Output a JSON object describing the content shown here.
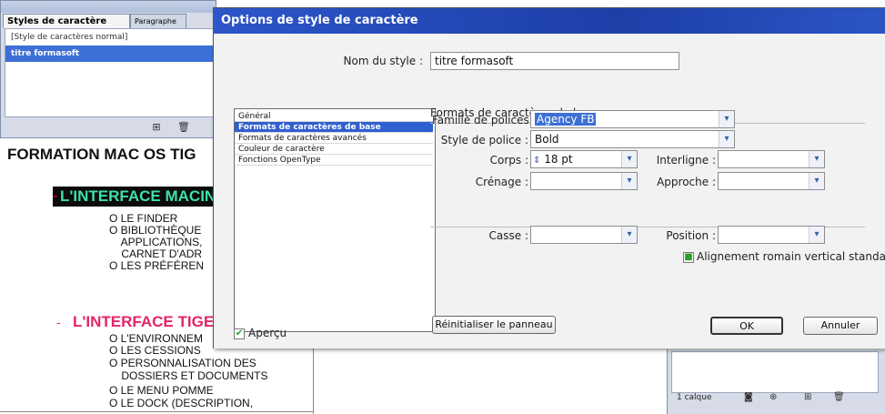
{
  "styles_panel": {
    "tabs": [
      "Styles de caractère",
      "Paragraphe"
    ],
    "items": [
      "[Style de caractères normal]",
      "titre formasoft"
    ],
    "new_icon": "new-style-icon",
    "trash_icon": "trash-icon"
  },
  "document": {
    "title": "FORMATION MAC OS TIG",
    "heading1": "L'INTERFACE MACIN",
    "heading1_bullet": "-",
    "bullets1": [
      "O  LE FINDER",
      "O  BIBLIOTHÈQUE",
      "    APPLICATIONS,",
      "    CARNET D'ADR",
      "O  LES PRÉFÉREN"
    ],
    "heading2": "L'INTERFACE TIGER",
    "heading2_bullet": "-",
    "bullets2": [
      "O  L'ENVIRONNEM",
      "O  LES CESSIONS",
      "O  PERSONNALISATION DES",
      "    DOSSIERS ET DOCUMENTS",
      "O  LE MENU POMME",
      "O  LE DOCK (DESCRIPTION,"
    ],
    "heading1_color": "#3de0a6",
    "heading2_color": "#e5246a"
  },
  "layers_panel": {
    "count_label": "1 calque"
  },
  "dialog": {
    "title": "Options de style de caractère",
    "style_name_label": "Nom du style :",
    "style_name_value": "titre formasoft",
    "categories": [
      "Général",
      "Formats de caractères de base",
      "Formats de caractères avancés",
      "Couleur de caractère",
      "Fonctions OpenType"
    ],
    "selected_category": "Formats de caractères de base",
    "section_title": "Formats de caractères de base",
    "font_family_label": "Famille de polices :",
    "font_family_value": "Agency FB",
    "font_style_label": "Style de police :",
    "font_style_value": "Bold",
    "size_label": "Corps :",
    "size_value": "18 pt",
    "leading_label": "Interligne :",
    "leading_value": "",
    "kerning_label": "Crénage :",
    "kerning_value": "",
    "tracking_label": "Approche :",
    "tracking_value": "",
    "case_label": "Casse :",
    "case_value": "",
    "position_label": "Position :",
    "position_value": "",
    "vertical_roman_label": "Alignement romain vertical standard",
    "vertical_roman_checked": true,
    "preview_label": "Aperçu",
    "preview_checked": true,
    "reset_button": "Réinitialiser le panneau",
    "ok_button": "OK",
    "cancel_button": "Annuler",
    "accent_color": "#2d56c9"
  }
}
